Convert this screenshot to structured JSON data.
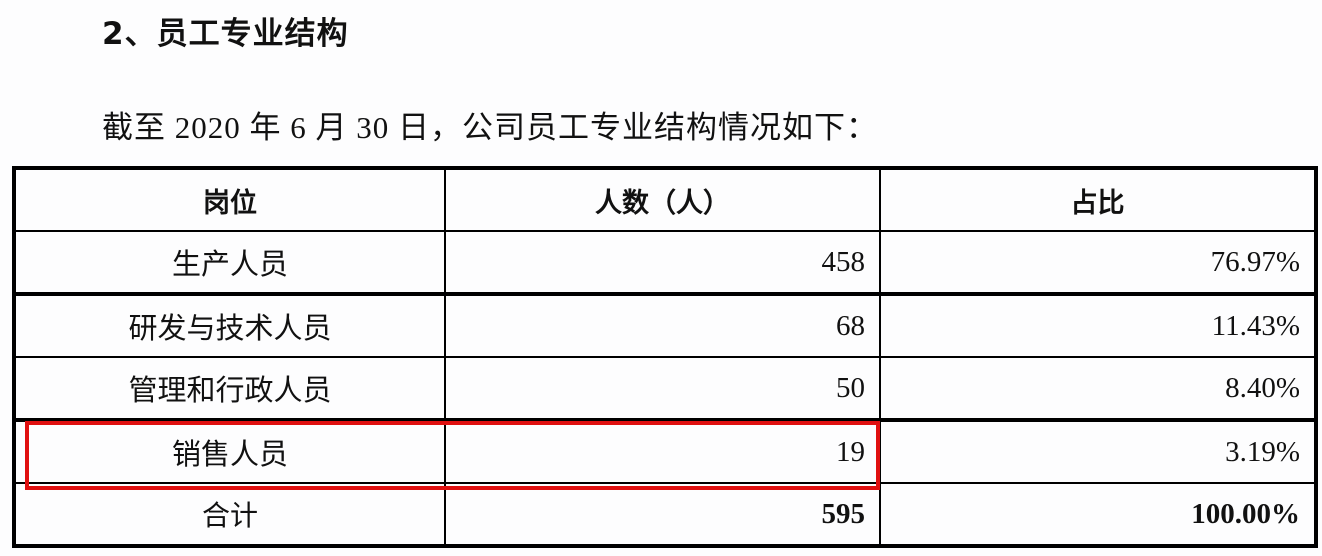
{
  "heading": "2、员工专业结构",
  "intro": "截至 2020 年 6 月 30 日，公司员工专业结构情况如下：",
  "table": {
    "headers": [
      "岗位",
      "人数（人）",
      "占比"
    ],
    "rows": [
      {
        "position": "生产人员",
        "count": "458",
        "ratio": "76.97%"
      },
      {
        "position": "研发与技术人员",
        "count": "68",
        "ratio": "11.43%"
      },
      {
        "position": "管理和行政人员",
        "count": "50",
        "ratio": "8.40%"
      },
      {
        "position": "销售人员",
        "count": "19",
        "ratio": "3.19%"
      }
    ],
    "total": {
      "position": "合计",
      "count": "595",
      "ratio": "100.00%"
    }
  },
  "highlight": {
    "row_label": "销售人员",
    "color": "#e01010"
  }
}
